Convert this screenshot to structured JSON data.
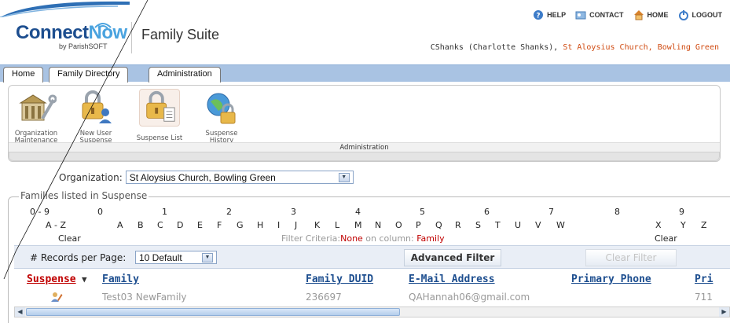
{
  "header": {
    "logo_connect": "Connect",
    "logo_now": "Now",
    "logo_by": "by ParishSOFT",
    "suite_title": "Family Suite",
    "links": [
      "HELP",
      "CONTACT",
      "HOME",
      "LOGOUT"
    ],
    "user": "CShanks (Charlotte Shanks),",
    "church": "St Aloysius Church, Bowling Green"
  },
  "tabs": [
    "Home",
    "Family Directory",
    "Administration"
  ],
  "admin_panel": {
    "items": [
      {
        "label_line1": "Organization",
        "label_line2": "Maintenance",
        "icon": "building-tools-icon"
      },
      {
        "label_line1": "New User",
        "label_line2": "Suspense",
        "icon": "lock-user-icon"
      },
      {
        "label_line1": "Suspense List",
        "label_line2": "",
        "icon": "lock-list-icon"
      },
      {
        "label_line1": "Suspense",
        "label_line2": "History",
        "icon": "lock-globe-icon"
      }
    ],
    "caption": "Administration"
  },
  "organization": {
    "label": "Organization:",
    "selected": "St Aloysius Church, Bowling Green"
  },
  "families": {
    "legend": "Families listed in Suspense",
    "numeric_filters": [
      "0 - 9",
      "0",
      "1",
      "2",
      "3",
      "4",
      "5",
      "6",
      "7",
      "8",
      "9"
    ],
    "alpha_filters": [
      "A - Z",
      "A",
      "B",
      "C",
      "D",
      "E",
      "F",
      "G",
      "H",
      "I",
      "J",
      "K",
      "L",
      "M",
      "N",
      "O",
      "P",
      "Q",
      "R",
      "S",
      "T",
      "U",
      "V",
      "W",
      "X",
      "Y",
      "Z"
    ],
    "clear_left": "Clear",
    "clear_right": "Clear",
    "filter_prefix": "Filter Criteria:",
    "filter_value": "None",
    "filter_mid": " on column: ",
    "filter_column": "Family"
  },
  "toolbar": {
    "records_label": "# Records per Page:",
    "records_value": "10 Default",
    "advanced_filter": "Advanced Filter",
    "clear_filter": "Clear Filter"
  },
  "grid": {
    "columns": [
      "Suspense",
      "Family",
      "Family DUID",
      "E-Mail Address",
      "Primary Phone",
      "Pri"
    ],
    "sort_arrow": "▼",
    "rows": [
      {
        "family": "Test03 NewFamily",
        "duid": "236697",
        "email": "QAHannah06@gmail.com",
        "phone": "",
        "pri": "711"
      }
    ]
  },
  "colors": {
    "brand_blue": "#1d4e8f",
    "accent_orange": "#d04a10",
    "tab_strip": "#a9c3e3",
    "filter_red": "#c00000"
  }
}
